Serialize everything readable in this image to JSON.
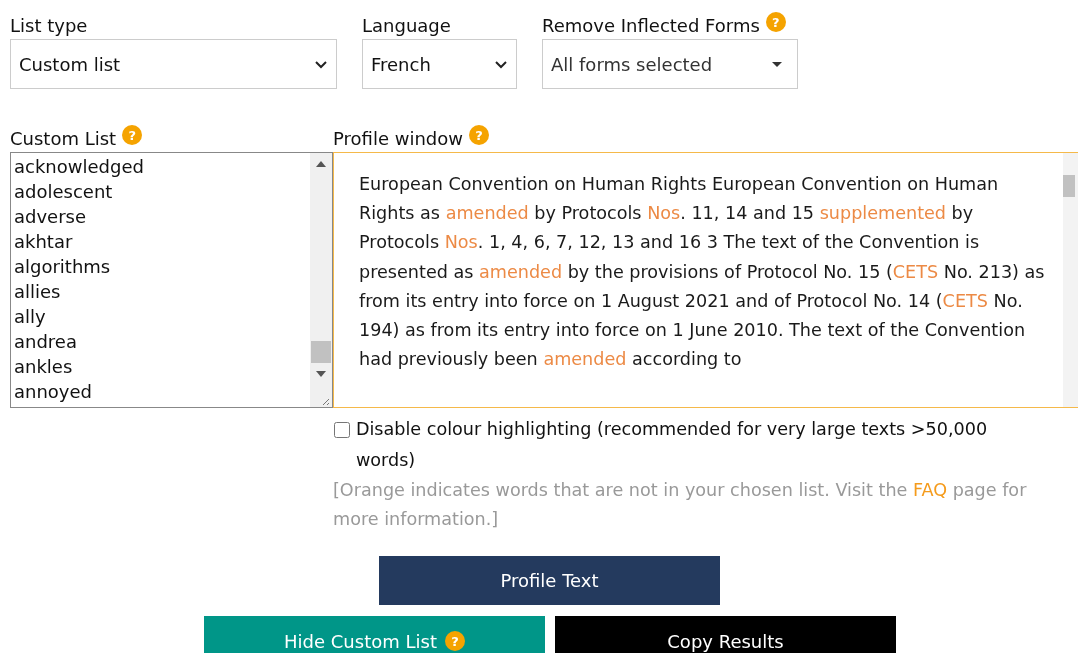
{
  "list_type": {
    "label": "List type",
    "value": "Custom list"
  },
  "language": {
    "label": "Language",
    "value": "French"
  },
  "inflected_forms": {
    "label": "Remove Inflected Forms",
    "value": "All forms selected",
    "help": "?"
  },
  "custom_list": {
    "label": "Custom List",
    "help": "?",
    "items": [
      "acknowledged",
      "adolescent",
      "adverse",
      "akhtar",
      "algorithms",
      "allies",
      "ally",
      "andrea",
      "ankles",
      "annoyed"
    ]
  },
  "profile_window": {
    "label": "Profile window",
    "help": "?",
    "segments": [
      {
        "text": "European Convention on Human Rights European Convention on Human Rights as ",
        "not_in_list": "amended"
      },
      {
        "text": " by Protocols ",
        "not_in_list": "Nos"
      },
      {
        "text": ". 11, 14 and 15 ",
        "not_in_list": "supplemented"
      },
      {
        "text": " by Protocols ",
        "not_in_list": "Nos"
      },
      {
        "text": ". 1, 4, 6, 7, 12, 13 and 16 3 The text of the Convention is presented as ",
        "not_in_list": "amended"
      },
      {
        "text": " by the provisions of Protocol No. 15 (",
        "not_in_list": "CETS"
      },
      {
        "text": " No. 213) as from its entry into force on 1 August 2021 and of Protocol No. 14 (",
        "not_in_list": "CETS"
      },
      {
        "text": " No. 194) as from its entry into force on 1 June 2010. The text of the Convention had previously been ",
        "not_in_list": "amended"
      },
      {
        "text": " according to"
      }
    ]
  },
  "disable_highlighting": {
    "label": "Disable colour highlighting (recommended for very large texts >50,000 words)",
    "checked": false
  },
  "note": {
    "before": "[Orange indicates words that are not in your chosen list. Visit the",
    "link": "FAQ",
    "after": "page for more information.]"
  },
  "buttons": {
    "profile": "Profile Text",
    "hide": "Hide Custom List",
    "hide_help": "?",
    "copy": "Copy Results"
  }
}
